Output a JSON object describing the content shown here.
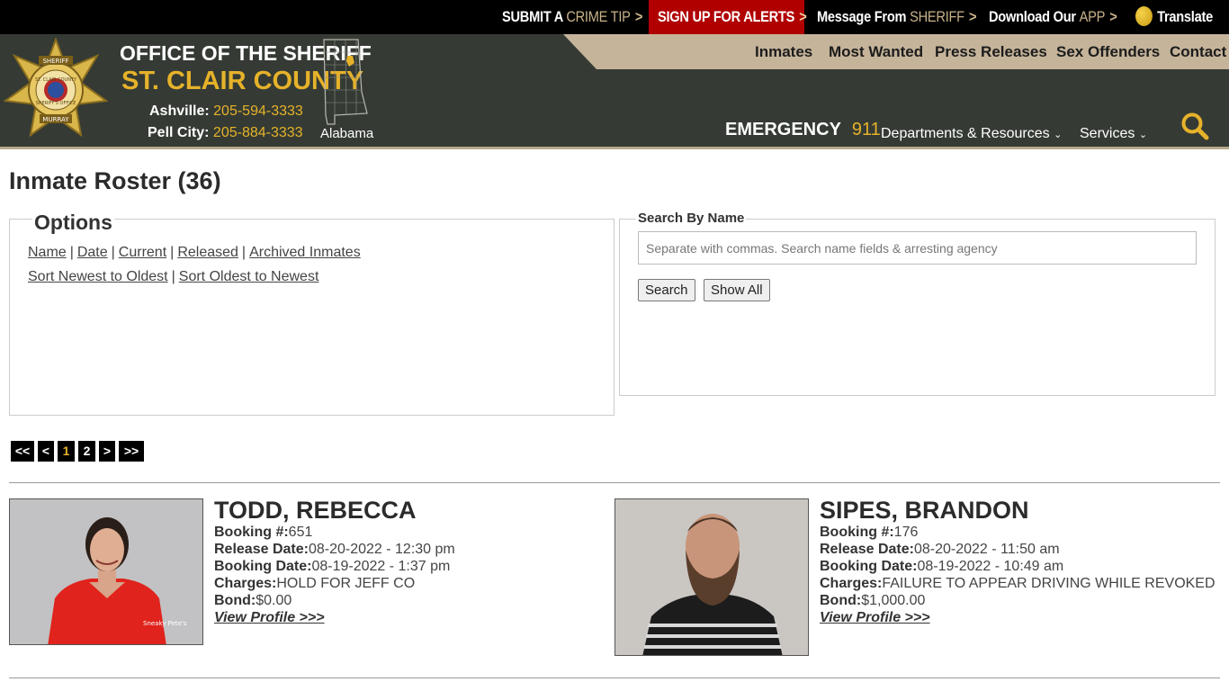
{
  "topbar": {
    "crime_tip_prefix": "SUBMIT A",
    "crime_tip_accent": "CRIME TIP",
    "alerts_label": "SIGN UP FOR ALERTS",
    "message_prefix": "Message From",
    "message_accent": "SHERIFF",
    "app_prefix": "Download Our",
    "app_accent": "APP",
    "translate_label": "Translate",
    "chevron": ">"
  },
  "header": {
    "badge_line1": "SHERIFF",
    "badge_line2": "ST. CLAIR COUNTY",
    "badge_line3": "SHERIFF'S OFFICE",
    "badge_line4": "MURRAY",
    "office_title": "OFFICE OF THE SHERIFF",
    "county_title": "ST. CLAIR COUNTY",
    "phone1_label": "Ashville:",
    "phone1_number": "205-594-3333",
    "phone2_label": "Pell City:",
    "phone2_number": "205-884-3333",
    "state_label": "Alabama",
    "emergency_label": "EMERGENCY",
    "emergency_number": "911",
    "dept_label": "Departments & Resources",
    "services_label": "Services",
    "nav": [
      "Inmates",
      "Most Wanted",
      "Press Releases",
      "Sex Offenders",
      "Contact"
    ]
  },
  "main": {
    "title": "Inmate Roster (36)",
    "options": {
      "legend": "Options",
      "line1": [
        "Name",
        "Date",
        "Current",
        "Released",
        "Archived Inmates"
      ],
      "line2": [
        "Sort Newest to Oldest",
        "Sort Oldest to Newest"
      ],
      "sep": "|"
    },
    "search": {
      "legend": "Search By Name",
      "placeholder": "Separate with commas. Search name fields & arresting agency",
      "search_button": "Search",
      "show_all_button": "Show All"
    },
    "pagination": [
      "<<",
      "<",
      "1",
      "2",
      ">",
      ">>"
    ],
    "inmates": [
      {
        "name": "TODD, REBECCA",
        "booking_label": "Booking #:",
        "booking": "651",
        "release_label": "Release Date:",
        "release": "08-20-2022 - 12:30 pm",
        "booking_date_label": "Booking Date:",
        "booking_date": "08-19-2022 - 1:37 pm",
        "charges_label": "Charges:",
        "charges": "HOLD FOR JEFF CO",
        "bond_label": "Bond:",
        "bond": "$0.00",
        "profile_link": "View Profile >>>",
        "shirt_text": "Sneaky Pete's"
      },
      {
        "name": "SIPES, BRANDON",
        "booking_label": "Booking #:",
        "booking": "176",
        "release_label": "Release Date:",
        "release": "08-20-2022 - 11:50 am",
        "booking_date_label": "Booking Date:",
        "booking_date": "08-19-2022 - 10:49 am",
        "charges_label": "Charges:",
        "charges": "FAILURE TO APPEAR DRIVING WHILE REVOKED",
        "bond_label": "Bond:",
        "bond": "$1,000.00",
        "profile_link": "View Profile >>>"
      }
    ]
  },
  "colors": {
    "header_bg": "#353b34",
    "nav_tan": "#c5b49a",
    "gold": "#e6b22a",
    "alerts_red": "#b00000"
  }
}
